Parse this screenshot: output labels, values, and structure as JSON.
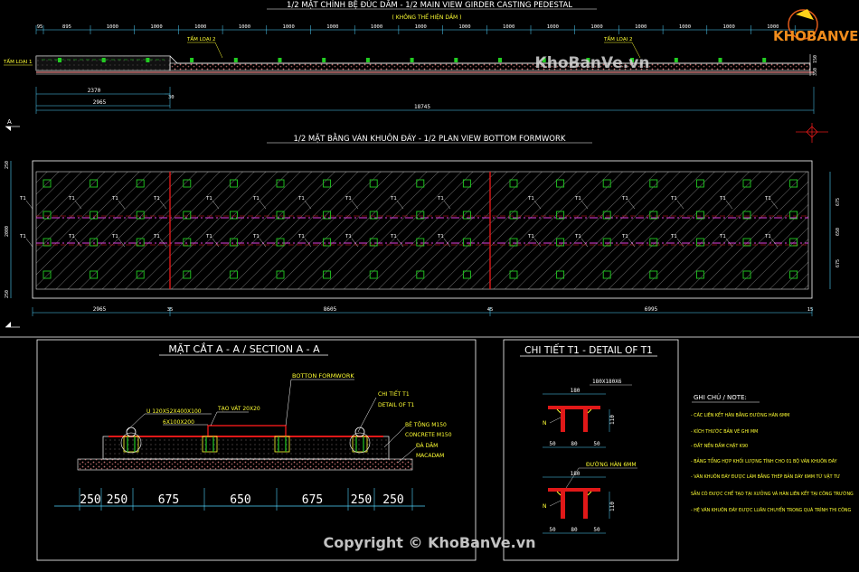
{
  "colors": {
    "background": "#000000",
    "line_white": "#ffffff",
    "dim_cyan": "#4fd4ff",
    "hatch": "#b9b9b9",
    "pad_green": "#22cc22",
    "red": "#e01818",
    "magenta": "#e040e0",
    "yellow": "#ffff33",
    "concrete": "#d8b8b8",
    "gravel": "#c07070",
    "logo_orange": "#f08c1c",
    "logo_yellow": "#ffd21a"
  },
  "main_view": {
    "title": "1/2 MẶT CHÍNH BỆ ĐÚC DẦM - 1/2 MAIN VIEW GIRDER CASTING PEDESTAL",
    "subtitle": "( KHÔNG THỂ HIỆN DẦM )",
    "top_dims": [
      "95",
      "895",
      "1000",
      "1000",
      "1000",
      "1000",
      "1000",
      "1000",
      "1000",
      "1000",
      "1000",
      "1000",
      "1000",
      "1000",
      "1000",
      "1000",
      "1000",
      "1000"
    ],
    "labels": {
      "plate1": "TẤM LOẠI 1",
      "plate2_left": "TẤM LOẠI 2",
      "plate2_right": "TẤM LOẠI 2"
    },
    "bottom_dims": {
      "d2370": "2370",
      "d30": "30",
      "d2965": "2965",
      "d18745": "18745"
    },
    "right_dims": [
      "150",
      "350"
    ]
  },
  "plan_view": {
    "title": "1/2 MẶT BẰNG VÁN KHUÔN ĐÁY - 1/2 PLAN VIEW BOTTOM FORMWORK",
    "section_marker": "A",
    "tag": "T1",
    "left_dims": [
      "250",
      "2000",
      "250"
    ],
    "right_dims": [
      "675",
      "650",
      "675"
    ],
    "bottom_dims": [
      "2965",
      "35",
      "8605",
      "45",
      "6995",
      "15"
    ]
  },
  "section": {
    "title": "MẶT CẮT A - A / SECTION A - A",
    "labels": {
      "bottom_formwork": "BOTTON FORMWORK",
      "channel": "U 120X52X400X100",
      "angle_pad": "6X100X200",
      "camber": "TẠO VÁT 20X20",
      "detail_ref1": "CHI TIẾT T1",
      "detail_ref2": "DETAIL OF T1",
      "concrete1": "BÊ TÔNG M150",
      "concrete2": "CONCRETE M150",
      "gravel1": "ĐÁ DĂM",
      "gravel2": "MACADAM"
    },
    "dims": [
      "250",
      "250",
      "675",
      "650",
      "675",
      "250",
      "250"
    ]
  },
  "detail": {
    "title": "CHI TIẾT T1 - DETAIL OF T1",
    "plate_size": "180X180X6",
    "weld": "ĐƯỜNG HÀN 6MM",
    "tag_n": "N",
    "dims_top": "180",
    "dims_side": "110",
    "dims_bottom": [
      "50",
      "80",
      "50"
    ]
  },
  "notes": {
    "heading": "GHI CHÚ / NOTE:",
    "items": [
      "- CÁC LIÊN KẾT HÀN BẰNG ĐƯỜNG HÀN 6MM",
      "- KÍCH THƯỚC BẢN VẼ GHI MM",
      "- ĐẤT NỀN ĐẦM CHẶT K90",
      "- BẢNG TỔNG HỢP KHỐI LƯỢNG TÍNH CHO 01 BỘ VÁN KHUÔN ĐÁY",
      "- VÁN KHUÔN ĐÁY ĐƯỢC LÀM BẰNG THÉP BẢN DÀY 6MM TỪ VẬT TƯ",
      "  SẴN CÓ ĐƯỢC CHẾ TẠO TẠI XƯỞNG VÀ HÀN LIÊN KẾT TẠI CÔNG TRƯỜNG",
      "- HỆ VÁN KHUÔN ĐÁY ĐƯỢC LUÂN CHUYỂN TRONG QUÁ TRÌNH THI CÔNG"
    ]
  },
  "watermark": {
    "logo": "KHOBANVE",
    "site": "KhoBanVe.vn",
    "copyright": "Copyright © KhoBanVe.vn"
  }
}
